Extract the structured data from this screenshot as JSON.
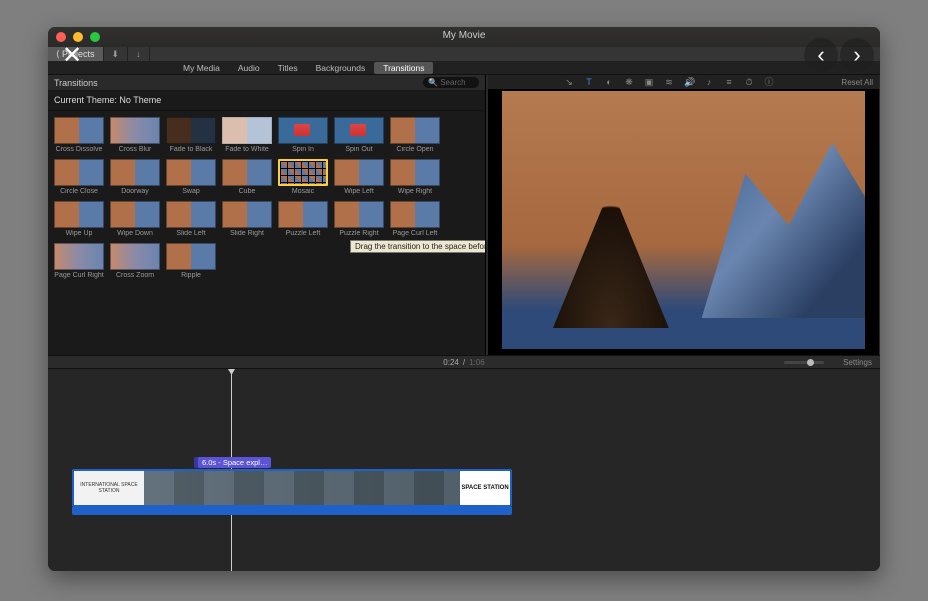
{
  "window": {
    "title": "My Movie"
  },
  "toolbar": {
    "projects": "Projects",
    "import_hint": "↓"
  },
  "tabs": {
    "items": [
      "My Media",
      "Audio",
      "Titles",
      "Backgrounds",
      "Transitions"
    ],
    "active": "Transitions"
  },
  "panel": {
    "title": "Transitions",
    "search_placeholder": "Search",
    "theme_label": "Current Theme: No Theme"
  },
  "transitions": [
    {
      "label": "Cross Dissolve",
      "style": "default"
    },
    {
      "label": "Cross Blur",
      "style": "blurred"
    },
    {
      "label": "Fade to Black",
      "style": "dark"
    },
    {
      "label": "Fade to White",
      "style": "white"
    },
    {
      "label": "Spin In",
      "style": "spin"
    },
    {
      "label": "Spin Out",
      "style": "spin"
    },
    {
      "label": "Circle Open",
      "style": "default"
    },
    {
      "label": "Circle Close",
      "style": "default"
    },
    {
      "label": "Doorway",
      "style": "default"
    },
    {
      "label": "Swap",
      "style": "default"
    },
    {
      "label": "Cube",
      "style": "default"
    },
    {
      "label": "Mosaic",
      "style": "mosaic",
      "selected": true
    },
    {
      "label": "Wipe Left",
      "style": "default"
    },
    {
      "label": "Wipe Right",
      "style": "default"
    },
    {
      "label": "Wipe Up",
      "style": "default"
    },
    {
      "label": "Wipe Down",
      "style": "default"
    },
    {
      "label": "Slide Left",
      "style": "default"
    },
    {
      "label": "Slide Right",
      "style": "default"
    },
    {
      "label": "Puzzle Left",
      "style": "default"
    },
    {
      "label": "Puzzle Right",
      "style": "default"
    },
    {
      "label": "Page Curl Left",
      "style": "default"
    },
    {
      "label": "Page Curl Right",
      "style": "blurred"
    },
    {
      "label": "Cross Zoom",
      "style": "blurred"
    },
    {
      "label": "Ripple",
      "style": "default"
    }
  ],
  "tooltip": "Drag the transition to the space before or after a clip",
  "preview_tools": {
    "items": [
      "adjust",
      "text",
      "color-balance",
      "color-wheel",
      "crop",
      "stabilize",
      "volume",
      "noise",
      "eq",
      "speed",
      "info"
    ],
    "active": "text",
    "reset": "Reset All"
  },
  "timecode": {
    "current": "0:24",
    "sep": " / ",
    "total": "1:06"
  },
  "settings_label": "Settings",
  "clip": {
    "tag": "6.0s - Space expl…",
    "slate_line1": "INTERNATIONAL SPACE STATION",
    "slate_line2": "",
    "logo": "SPACE STATION"
  }
}
